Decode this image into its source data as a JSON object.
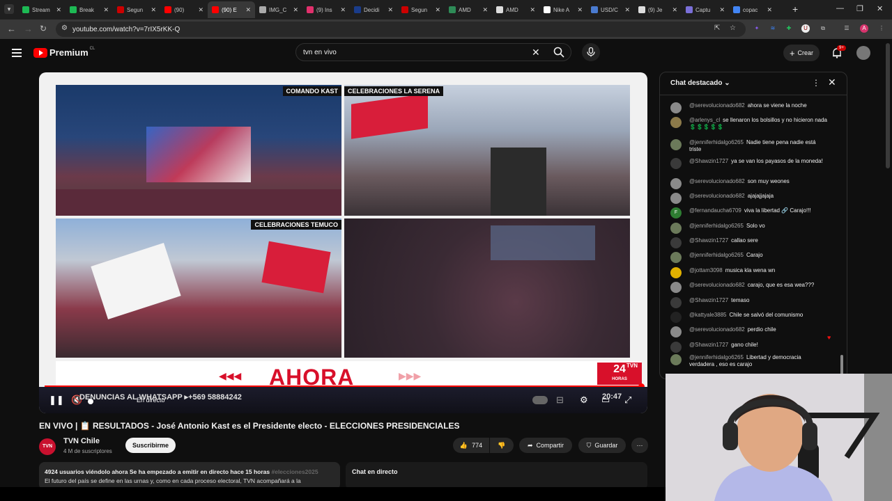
{
  "browser": {
    "tabs": [
      {
        "label": "Stream",
        "color": "#1db954"
      },
      {
        "label": "Break",
        "color": "#1db954"
      },
      {
        "label": "Segun",
        "color": "#cc0000"
      },
      {
        "label": "(90)",
        "color": "#ff0000"
      },
      {
        "label": "(90) E",
        "color": "#ff0000",
        "active": true
      },
      {
        "label": "IMG_C",
        "color": "#aaaaaa"
      },
      {
        "label": "(9) Ins",
        "color": "#e1306c"
      },
      {
        "label": "Decidi",
        "color": "#1a3c8a"
      },
      {
        "label": "Segun",
        "color": "#cc0000"
      },
      {
        "label": "AMD",
        "color": "#2e8b57"
      },
      {
        "label": "AMD",
        "color": "#dddddd"
      },
      {
        "label": "Nike A",
        "color": "#ffffff"
      },
      {
        "label": "USD/C",
        "color": "#4a7bd0"
      },
      {
        "label": "(9) Je",
        "color": "#dddddd"
      },
      {
        "label": "Captu",
        "color": "#7a6fd8"
      },
      {
        "label": "copac",
        "color": "#4285f4"
      }
    ],
    "url": "youtube.com/watch?v=7rIX5rKK-Q",
    "profile_initial": "A"
  },
  "youtube": {
    "logo_text": "Premium",
    "country": "CL",
    "search_value": "tvn en vivo",
    "create_label": "Crear",
    "notif_count": "9+"
  },
  "video": {
    "quad_labels": [
      "COMANDO KAST",
      "CELEBRACIONES LA SERENA",
      "CELEBRACIONES TEMUCO"
    ],
    "banner_text": "AHORA",
    "badge_text": "24",
    "badge_sub": "HORAS",
    "badge_brand": "TVN",
    "ticker": "DENUNCIAS AL WHATSAPP ▸+569 58884242",
    "live_label": "En directo",
    "time": "20:47"
  },
  "meta": {
    "title": "EN VIVO | 📋 RESULTADOS - José Antonio Kast es el Presidente electo - ELECCIONES PRESIDENCIALES",
    "channel": "TVN Chile",
    "channel_avatar": "TVN",
    "subs": "4 M de suscriptores",
    "subscribe": "Suscribirme",
    "likes": "774",
    "share": "Compartir",
    "save": "Guardar",
    "desc_meta": "4924 usuarios viéndolo ahora  Se ha empezado a emitir en directo hace 15 horas",
    "desc_tag": " #elecciones2025",
    "desc_text": "El futuro del país se define en las urnas y, como en cada proceso electoral, TVN acompañará a la",
    "live_chat_label": "Chat en directo"
  },
  "chat": {
    "title": "Chat destacado",
    "messages": [
      {
        "author": "@serevolucionado682",
        "text": "ahora se viene la noche",
        "color": "#8a8a8a"
      },
      {
        "author": "@arlenys_cl",
        "text": "se llenaron los bolsillos y no hicieron nada 💲💲💲💲💲",
        "color": "#8c7a4a"
      },
      {
        "author": "@jenniferhidalgo6265",
        "text": "Nadie tiene pena nadie está triste",
        "color": "#6b7a5a"
      },
      {
        "author": "@Shawzin1727",
        "text": "ya se van los payasos de la moneda!",
        "color": "#3a3a3a"
      },
      {
        "author": "@serevolucionado682",
        "text": "son muy weones",
        "color": "#8a8a8a"
      },
      {
        "author": "@serevolucionado682",
        "text": "ajajajjajaja",
        "color": "#8a8a8a"
      },
      {
        "author": "@fernandaucha6709",
        "text": "viva la libertad 🔗 Carajo!!!",
        "color": "#2e7d32",
        "initial": "F"
      },
      {
        "author": "@jenniferhidalgo6265",
        "text": "Solo vo",
        "color": "#6b7a5a"
      },
      {
        "author": "@Shawzin1727",
        "text": "callao sere",
        "color": "#3a3a3a"
      },
      {
        "author": "@jenniferhidalgo6265",
        "text": "Carajo",
        "color": "#6b7a5a"
      },
      {
        "author": "@jottam3098",
        "text": "musica kla wena wn",
        "color": "#e0b000"
      },
      {
        "author": "@serevolucionado682",
        "text": "carajo, que es esa wea???",
        "color": "#8a8a8a"
      },
      {
        "author": "@Shawzin1727",
        "text": "temaso",
        "color": "#3a3a3a"
      },
      {
        "author": "@kattyale3885",
        "text": "Chile se salvó del comunismo",
        "color": "#222222"
      },
      {
        "author": "@serevolucionado682",
        "text": "perdio chile",
        "color": "#8a8a8a"
      },
      {
        "author": "@Shawzin1727",
        "text": "gano chile!",
        "color": "#3a3a3a"
      },
      {
        "author": "@jenniferhidalgo6265",
        "text": "Libertad y democracia verdadera , eso es carajo",
        "color": "#6b7a5a"
      }
    ]
  }
}
